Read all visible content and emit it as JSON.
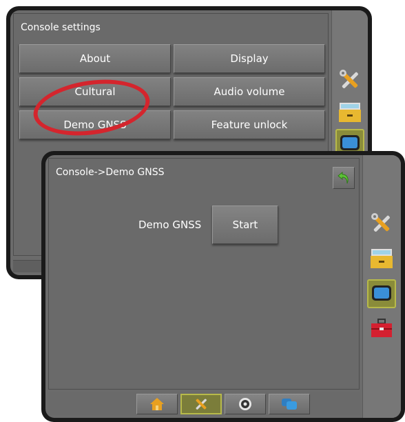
{
  "settings_window": {
    "title": "Console settings",
    "buttons": [
      {
        "label": "About"
      },
      {
        "label": "Display"
      },
      {
        "label": "Cultural"
      },
      {
        "label": "Audio volume"
      },
      {
        "label": "Demo GNSS"
      },
      {
        "label": "Feature unlock"
      }
    ],
    "side_icons": [
      "tools-icon",
      "storage-drawer-icon",
      "display-monitor-icon"
    ]
  },
  "demo_window": {
    "title": "Console->Demo GNSS",
    "field_label": "Demo GNSS",
    "start_label": "Start",
    "back_icon": "back-arrow-icon",
    "side_icons": [
      "tools-icon",
      "storage-drawer-icon",
      "display-monitor-icon",
      "toolbox-icon"
    ]
  },
  "bottom_tabs": [
    "home-icon",
    "tools-icon",
    "gps-target-icon",
    "monitor-icon"
  ],
  "colors": {
    "panel": "#6b6b6b",
    "frame": "#1a1a1a",
    "active_highlight": "#b8ba4a",
    "annotation": "#d4252d",
    "monitor_blue": "#3a8fd8",
    "toolbox_red": "#d42030",
    "drawer_yellow": "#e8b830"
  }
}
